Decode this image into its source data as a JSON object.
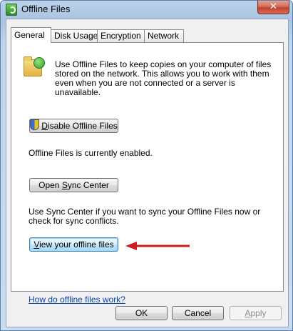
{
  "window": {
    "title": "Offline Files",
    "close_glyph": "✕"
  },
  "tabs": [
    {
      "label": "General",
      "active": true
    },
    {
      "label": "Disk Usage",
      "active": false
    },
    {
      "label": "Encryption",
      "active": false
    },
    {
      "label": "Network",
      "active": false
    }
  ],
  "general": {
    "description": "Use Offline Files to keep copies on your computer of files stored on the network.  This allows you to work with them even when you are not connected or a server is unavailable.",
    "disable_button_label_first": "D",
    "disable_button_label_rest": "isable Offline Files",
    "status_text": "Offline Files is currently enabled.",
    "sync_button_label_pre": "Open ",
    "sync_button_label_mn": "S",
    "sync_button_label_post": "ync Center",
    "sync_description": "Use Sync Center if you want to sync your Offline Files now or check for sync conflicts.",
    "view_button_label_mn": "V",
    "view_button_label_rest": "iew your offline files",
    "help_link": "How do offline files work?"
  },
  "footer": {
    "ok_label": "OK",
    "cancel_label": "Cancel",
    "apply_label_mn": "A",
    "apply_label_rest": "pply"
  },
  "colors": {
    "arrow": "#cc1e1e",
    "link": "#0645ad",
    "titlebar": "#a9c4e2"
  }
}
